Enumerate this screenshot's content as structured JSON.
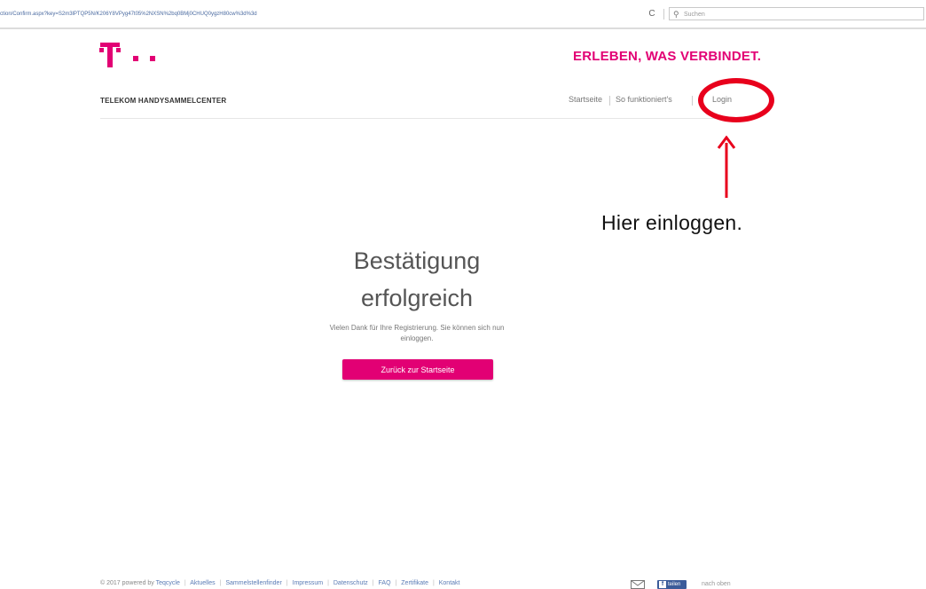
{
  "browser": {
    "url": "ction/Confirm.aspx?key=S2m3lPTQP5N/K206Y8VPyg47t05%2NXSN%2bq0BMj0CHUQ0ygzH80cw%3d%3d",
    "reload_glyph": "C",
    "search_placeholder": "Suchen",
    "search_icon": "magnifier-icon"
  },
  "header": {
    "logo_icon": "telekom-t-logo",
    "slogan": "ERLEBEN, WAS VERBINDET.",
    "brand_title": "TELEKOM HANDYSAMMELCENTER",
    "nav": [
      "Startseite",
      "So funktioniert's",
      "Login"
    ]
  },
  "annotation": {
    "hint": "Hier einloggen.",
    "color": "#e8001c"
  },
  "main": {
    "title_line1": "Bestätigung",
    "title_line2": "erfolgreich",
    "message_line1": "Vielen Dank für Ihre Registrierung. Sie können sich nun",
    "message_line2": "einloggen.",
    "button_label": "Zurück zur Startseite"
  },
  "footer": {
    "copyright": "© 2017 powered by",
    "powered_link": "Teqcycle",
    "links": [
      "Aktuelles",
      "Sammelstellenfinder",
      "Impressum",
      "Datenschutz",
      "FAQ",
      "Zertifikate",
      "Kontakt"
    ],
    "share_label": "teilen",
    "top_link": "nach oben"
  },
  "colors": {
    "brand_magenta": "#e20074",
    "facebook_blue": "#3b5b99"
  }
}
